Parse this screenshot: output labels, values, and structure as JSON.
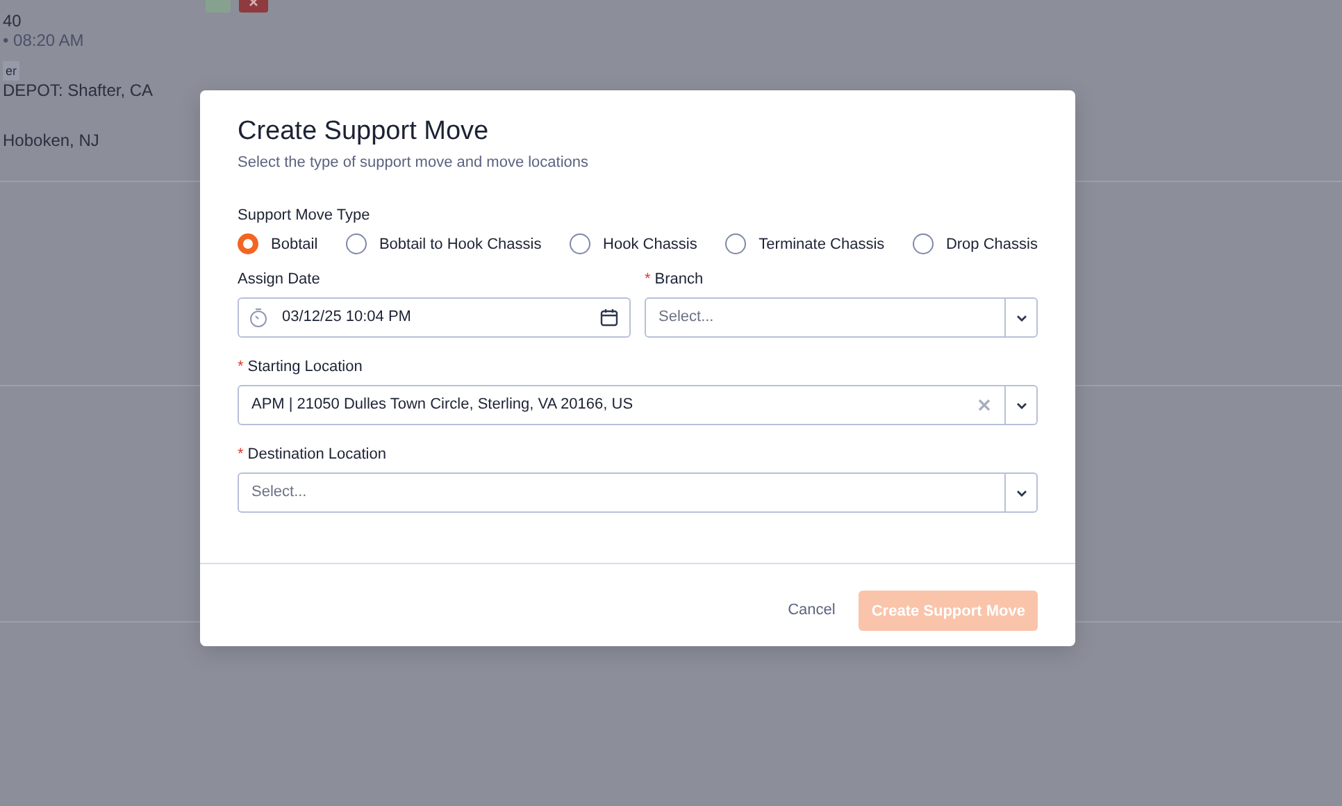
{
  "background": {
    "top_buttons": [
      {
        "kind": "green"
      },
      {
        "kind": "close"
      }
    ],
    "lines": [
      {
        "kind": "text",
        "text": "40"
      },
      {
        "kind": "muted",
        "text": "• 08:20 AM"
      },
      {
        "kind": "badge",
        "text": "er"
      },
      {
        "kind": "text",
        "text": "DEPOT: Shafter, CA"
      },
      {
        "kind": "gap",
        "text": "Hoboken, NJ"
      }
    ]
  },
  "modal": {
    "title": "Create Support Move",
    "subtitle": "Select the type of support move and move locations",
    "move_type": {
      "label": "Support Move Type",
      "options": [
        {
          "label": "Bobtail",
          "selected": true
        },
        {
          "label": "Bobtail to Hook Chassis",
          "selected": false
        },
        {
          "label": "Hook Chassis",
          "selected": false
        },
        {
          "label": "Terminate Chassis",
          "selected": false
        },
        {
          "label": "Drop Chassis",
          "selected": false
        }
      ]
    },
    "assign_date": {
      "label": "Assign Date",
      "value": "03/12/25 10:04 PM"
    },
    "branch": {
      "required_mark": "*",
      "label": "Branch",
      "placeholder": "Select..."
    },
    "starting_location": {
      "required_mark": "*",
      "label": "Starting Location",
      "value": "APM | 21050 Dulles Town Circle, Sterling, VA 20166, US"
    },
    "destination_location": {
      "required_mark": "*",
      "label": "Destination Location",
      "placeholder": "Select..."
    },
    "buttons": [
      {
        "kind": "link",
        "label": "Cancel"
      },
      {
        "kind": "primary",
        "label": "Create Support Move",
        "disabled": true
      }
    ]
  }
}
